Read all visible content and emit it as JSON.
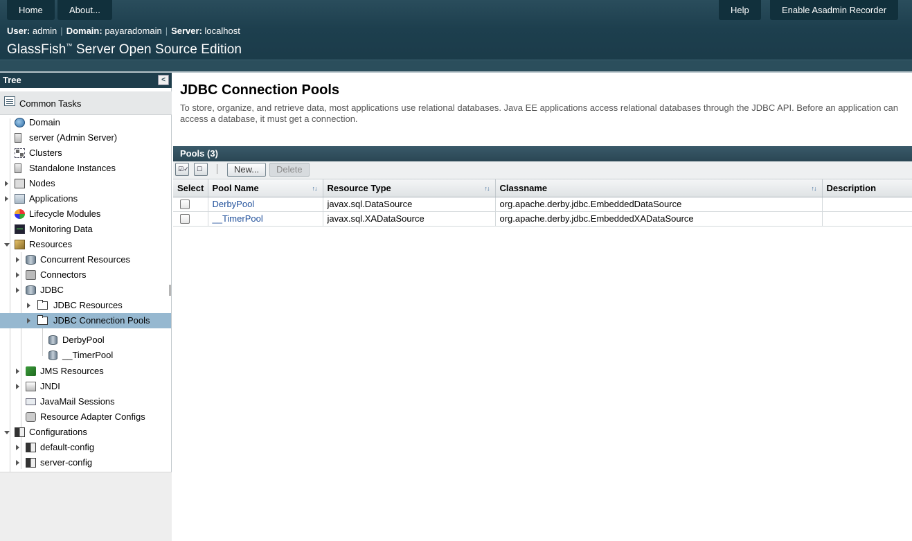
{
  "masthead": {
    "home_label": "Home",
    "about_label": "About...",
    "help_label": "Help",
    "recorder_label": "Enable Asadmin Recorder",
    "user_key": "User:",
    "user_value": "admin",
    "domain_key": "Domain:",
    "domain_value": "payaradomain",
    "server_key": "Server:",
    "server_value": "localhost",
    "product_name": "GlassFish",
    "product_tm": "™",
    "product_edition": " Server Open Source Edition"
  },
  "tree": {
    "header": "Tree",
    "collapse_glyph": "<",
    "common_tasks": "Common Tasks",
    "nodes": [
      {
        "label": "Domain",
        "icon": "globe-icon"
      },
      {
        "label": "server (Admin Server)",
        "icon": "server-icon"
      },
      {
        "label": "Clusters",
        "icon": "cluster-icon"
      },
      {
        "label": "Standalone Instances",
        "icon": "server-icon"
      },
      {
        "label": "Nodes",
        "icon": "nodes-icon"
      },
      {
        "label": "Applications",
        "icon": "applications-icon"
      },
      {
        "label": "Lifecycle Modules",
        "icon": "lifecycle-icon"
      },
      {
        "label": "Monitoring Data",
        "icon": "monitor-icon"
      },
      {
        "label": "Resources",
        "icon": "resources-icon"
      },
      {
        "label": "Concurrent Resources",
        "icon": "database-icon"
      },
      {
        "label": "Connectors",
        "icon": "connector-icon"
      },
      {
        "label": "JDBC",
        "icon": "database-icon"
      },
      {
        "label": "JDBC Resources",
        "icon": "folder-icon"
      },
      {
        "label": "JDBC Connection Pools",
        "icon": "folder-icon"
      },
      {
        "label": "DerbyPool",
        "icon": "database-icon"
      },
      {
        "label": "__TimerPool",
        "icon": "database-icon"
      },
      {
        "label": "JMS Resources",
        "icon": "jms-icon"
      },
      {
        "label": "JNDI",
        "icon": "jndi-icon"
      },
      {
        "label": "JavaMail Sessions",
        "icon": "mail-icon"
      },
      {
        "label": "Resource Adapter Configs",
        "icon": "adapter-icon"
      },
      {
        "label": "Configurations",
        "icon": "config-icon"
      },
      {
        "label": "default-config",
        "icon": "config-icon"
      },
      {
        "label": "server-config",
        "icon": "config-icon"
      }
    ]
  },
  "content": {
    "title": "JDBC Connection Pools",
    "help_text": "To store, organize, and retrieve data, most applications use relational databases. Java EE applications access relational databases through the JDBC API. Before an application can access a database, it must get a connection.",
    "table_title": "Pools (3)",
    "new_label": "New...",
    "delete_label": "Delete",
    "select_all_glyph": "☑✓",
    "deselect_all_glyph": "☐",
    "columns": [
      "Select",
      "Pool Name",
      "Resource Type",
      "Classname",
      "Description"
    ],
    "rows": [
      {
        "pool_name": "DerbyPool",
        "resource_type": "javax.sql.DataSource",
        "classname": "org.apache.derby.jdbc.EmbeddedDataSource",
        "description": ""
      },
      {
        "pool_name": "__TimerPool",
        "resource_type": "javax.sql.XADataSource",
        "classname": "org.apache.derby.jdbc.EmbeddedXADataSource",
        "description": ""
      }
    ]
  },
  "colors": {
    "masthead": "#1d3f4e",
    "selected_row": "#96b8d0",
    "link": "#1f4f9a"
  }
}
